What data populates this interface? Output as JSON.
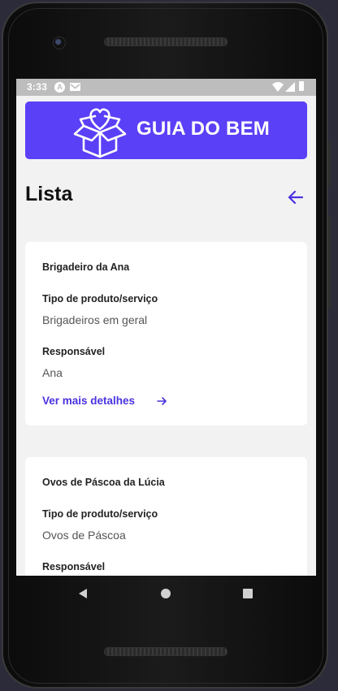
{
  "status_bar": {
    "time": "3:33",
    "notif_icon_1": "a-app-icon",
    "notif_icon_2": "gmail-icon",
    "icons": [
      "wifi-icon",
      "signal-icon",
      "battery-icon"
    ]
  },
  "banner": {
    "title": "GUIA DO BEM",
    "icon": "heart-box-icon",
    "color": "#5a40f6"
  },
  "page": {
    "title": "Lista",
    "back_icon": "arrow-left-icon"
  },
  "items": [
    {
      "name": "Brigadeiro da Ana",
      "type_label": "Tipo de produto/serviço",
      "type_value": "Brigadeiros em geral",
      "owner_label": "Responsável",
      "owner_value": "Ana",
      "link_label": "Ver mais detalhes"
    },
    {
      "name": "Ovos de Páscoa da Lúcia",
      "type_label": "Tipo de produto/serviço",
      "type_value": "Ovos de Páscoa",
      "owner_label": "Responsável"
    }
  ],
  "accent": "#4a33e0",
  "nav_bar": {
    "icons": [
      "back-triangle-icon",
      "home-circle-icon",
      "recents-square-icon"
    ]
  }
}
